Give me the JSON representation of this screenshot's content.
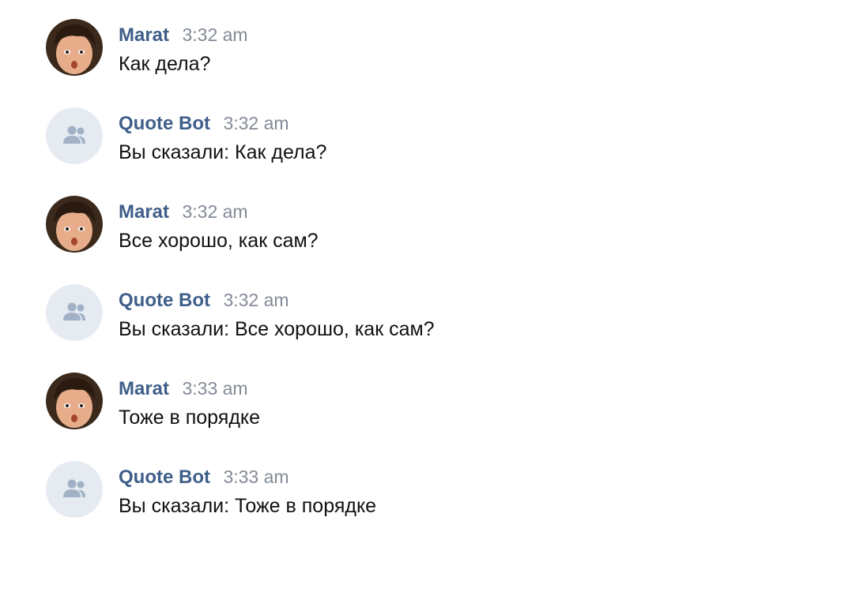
{
  "messages": [
    {
      "author": "Marat",
      "time": "3:32 am",
      "text": "Как дела?",
      "avatar": "photo-avatar"
    },
    {
      "author": "Quote Bot",
      "time": "3:32 am",
      "text": "Вы сказали: Как дела?",
      "avatar": "group-icon"
    },
    {
      "author": "Marat",
      "time": "3:32 am",
      "text": "Все хорошо, как сам?",
      "avatar": "photo-avatar"
    },
    {
      "author": "Quote Bot",
      "time": "3:32 am",
      "text": "Вы сказали: Все хорошо, как сам?",
      "avatar": "group-icon"
    },
    {
      "author": "Marat",
      "time": "3:33 am",
      "text": "Тоже в порядке",
      "avatar": "photo-avatar"
    },
    {
      "author": "Quote Bot",
      "time": "3:33 am",
      "text": "Вы сказали: Тоже в порядке",
      "avatar": "group-icon"
    }
  ],
  "colors": {
    "author": "#3f5f8a",
    "time": "#838b96",
    "text": "#111111",
    "bot_avatar_bg": "#e6ebf2",
    "bot_icon": "#a2b2c6"
  }
}
